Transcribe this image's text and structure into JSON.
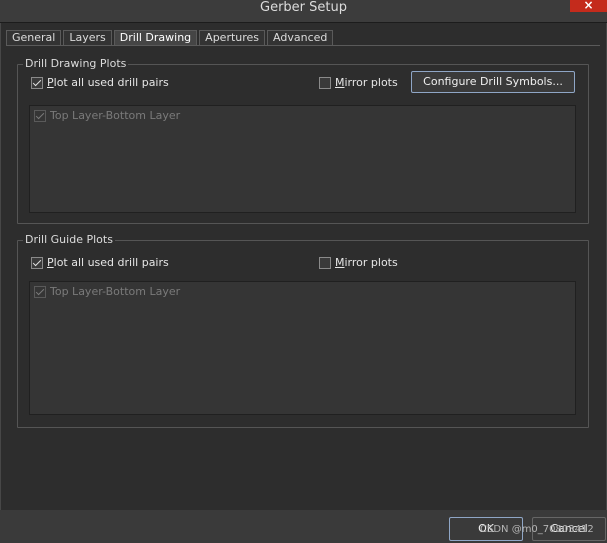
{
  "window": {
    "title": "Gerber Setup",
    "close_label": "×"
  },
  "tabs": [
    {
      "label": "General"
    },
    {
      "label": "Layers"
    },
    {
      "label": "Drill Drawing"
    },
    {
      "label": "Apertures"
    },
    {
      "label": "Advanced"
    }
  ],
  "drill_drawing": {
    "title": "Drill Drawing Plots",
    "plot_all_first": "P",
    "plot_all_rest": "lot all used drill pairs",
    "mirror_first": "M",
    "mirror_rest": "irror plots",
    "configure_label": "Configure Drill Symbols...",
    "list_item": "Top Layer-Bottom Layer"
  },
  "drill_guide": {
    "title": "Drill Guide Plots",
    "plot_all_first": "P",
    "plot_all_rest": "lot all used drill pairs",
    "mirror_first": "M",
    "mirror_rest": "irror plots",
    "list_item": "Top Layer-Bottom Layer"
  },
  "footer": {
    "ok_label": "OK",
    "cancel_label": "Cancel"
  },
  "watermark": "CSDN @m0_70803412"
}
